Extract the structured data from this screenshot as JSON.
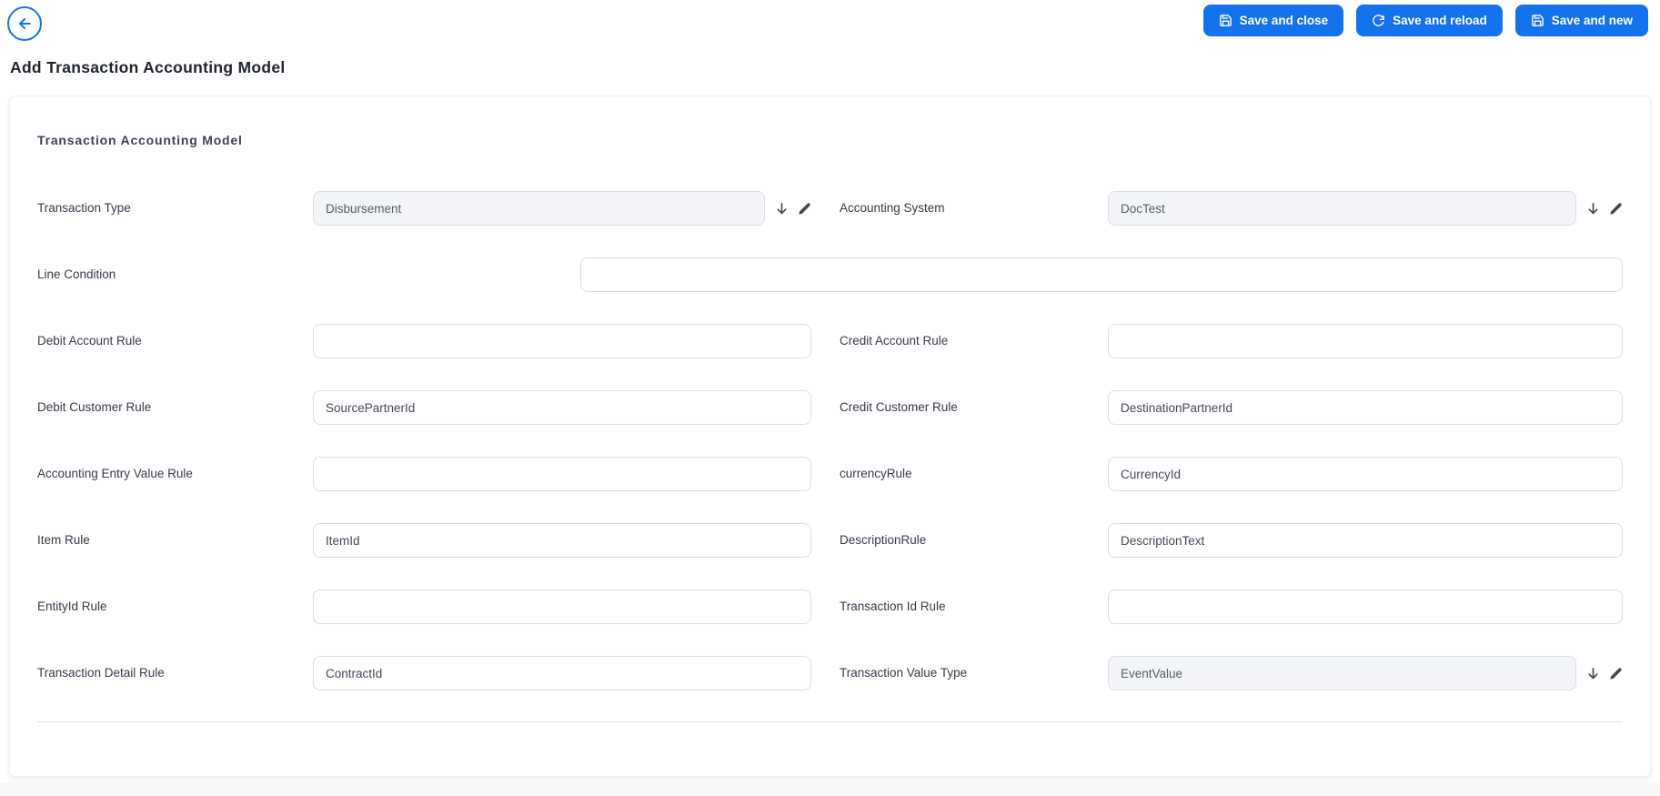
{
  "header": {
    "back_button": {
      "icon": "arrow-left-icon"
    },
    "buttons": [
      {
        "label": "Save and close",
        "icon": "save-icon"
      },
      {
        "label": "Save and reload",
        "icon": "reload-icon"
      },
      {
        "label": "Save and new",
        "icon": "save-icon"
      }
    ]
  },
  "page_title": "Add Transaction Accounting Model",
  "form": {
    "section_title": "Transaction Accounting Model",
    "fields": {
      "transaction_type": {
        "label": "Transaction Type",
        "value": "Disbursement",
        "type": "select"
      },
      "accounting_system": {
        "label": "Accounting System",
        "value": "DocTest",
        "type": "select"
      },
      "line_condition": {
        "label": "Line Condition",
        "value": "",
        "type": "text"
      },
      "debit_account_rule": {
        "label": "Debit Account Rule",
        "value": "",
        "type": "text"
      },
      "credit_account_rule": {
        "label": "Credit Account Rule",
        "value": "",
        "type": "text"
      },
      "debit_customer_rule": {
        "label": "Debit Customer Rule",
        "value": "SourcePartnerId",
        "type": "text"
      },
      "credit_customer_rule": {
        "label": "Credit Customer Rule",
        "value": "DestinationPartnerId",
        "type": "text"
      },
      "accounting_entry_value_rule": {
        "label": "Accounting Entry Value Rule",
        "value": "",
        "type": "text"
      },
      "currency_rule": {
        "label": "currencyRule",
        "value": "CurrencyId",
        "type": "text"
      },
      "item_rule": {
        "label": "Item Rule",
        "value": "ItemId",
        "type": "text"
      },
      "description_rule": {
        "label": "DescriptionRule",
        "value": "DescriptionText",
        "type": "text"
      },
      "entityid_rule": {
        "label": "EntityId Rule",
        "value": "",
        "type": "text"
      },
      "transaction_id_rule": {
        "label": "Transaction Id Rule",
        "value": "",
        "type": "text"
      },
      "transaction_detail_rule": {
        "label": "Transaction Detail Rule",
        "value": "ContractId",
        "type": "text"
      },
      "transaction_value_type": {
        "label": "Transaction Value Type",
        "value": "EventValue",
        "type": "select"
      }
    }
  },
  "icons": {
    "back": "arrow-left-icon",
    "save": "floppy-disk-icon",
    "reload": "refresh-icon",
    "dropdown": "arrow-down-icon",
    "edit": "pencil-icon"
  },
  "colors": {
    "accent_blue": "#1372ec",
    "title_text": "#20262e",
    "label_text": "#333b49",
    "input_border": "#d9dde8",
    "disabled_input_bg": "#f3f4f7",
    "divider": "#d8dfdf"
  }
}
